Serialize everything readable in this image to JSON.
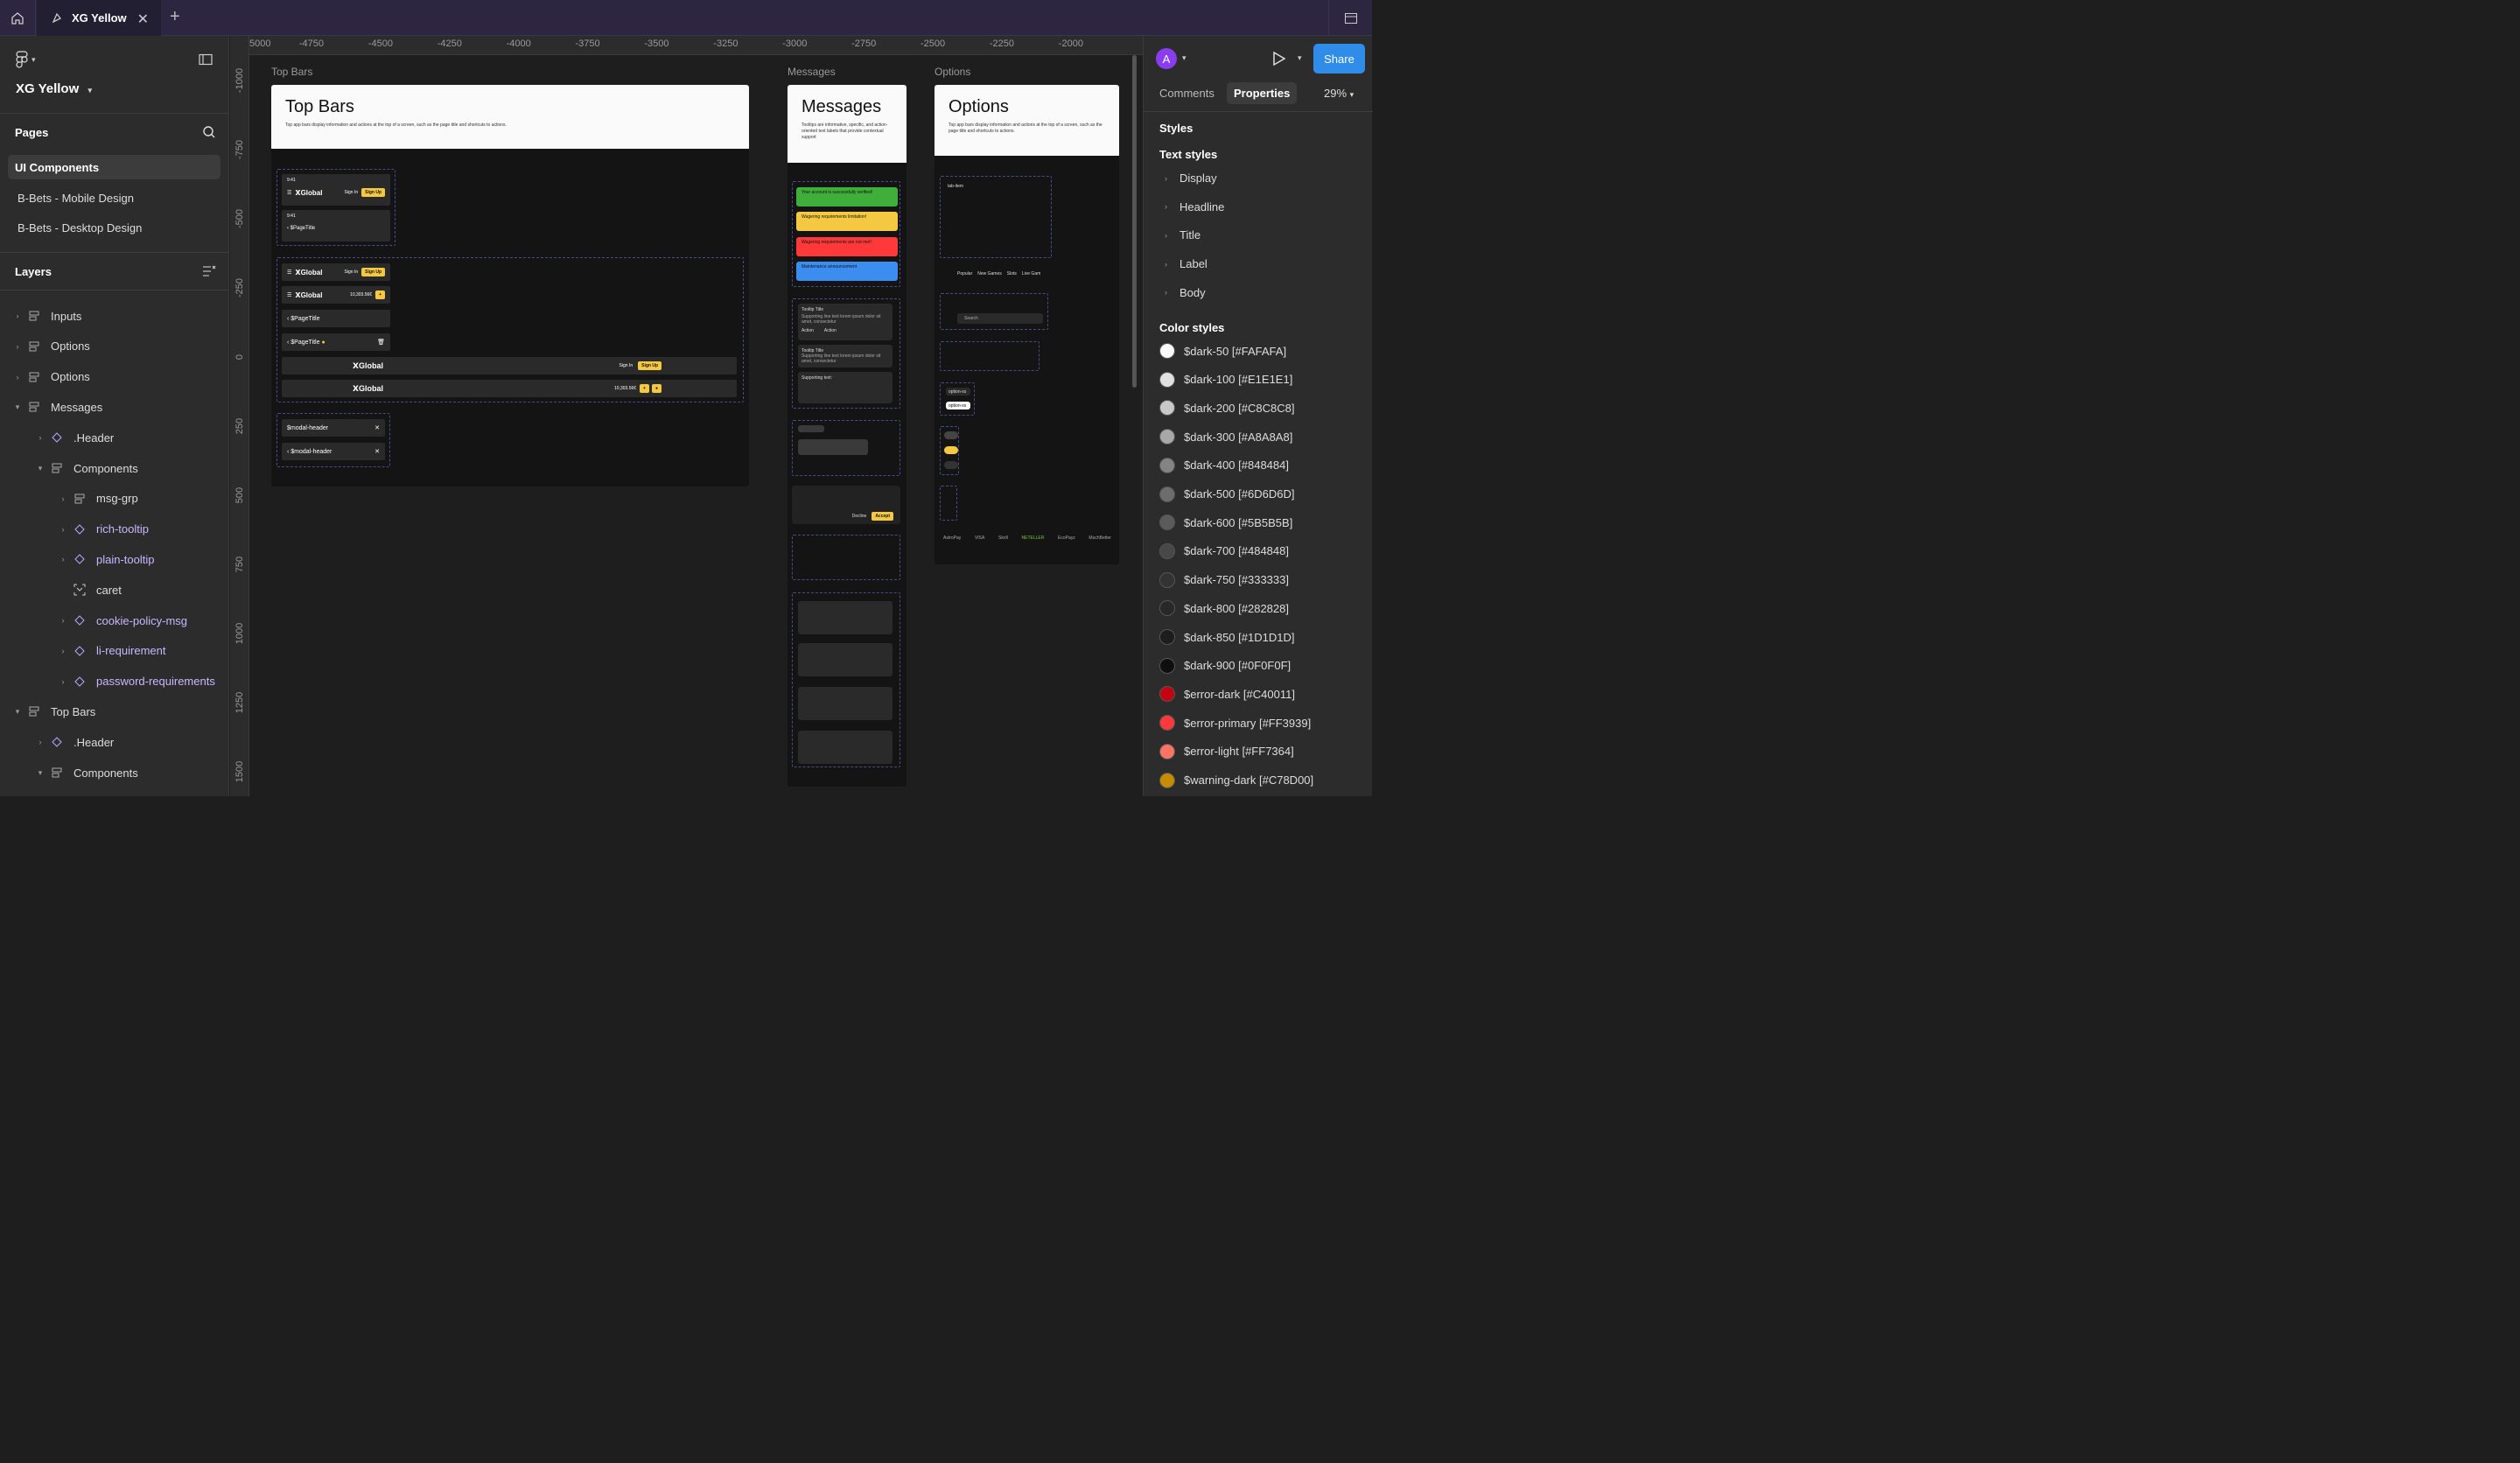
{
  "topbar": {
    "file_tab": "XG Yellow",
    "home_icon": "home-icon",
    "file_icon": "figma-file-icon",
    "close_icon": "close-icon",
    "add_icon": "plus-icon",
    "panel_icon": "layout-icon"
  },
  "left": {
    "file_name": "XG Yellow",
    "pages_title": "Pages",
    "pages": [
      "UI Components",
      "B-Bets - Mobile Design",
      "B-Bets - Desktop Design"
    ],
    "layers_title": "Layers",
    "layers": [
      {
        "label": "Inputs",
        "depth": 0,
        "expanded": false,
        "kind": "frame"
      },
      {
        "label": "Options",
        "depth": 0,
        "expanded": false,
        "kind": "frame"
      },
      {
        "label": "Options",
        "depth": 0,
        "expanded": false,
        "kind": "frame"
      },
      {
        "label": "Messages",
        "depth": 0,
        "expanded": true,
        "kind": "frame"
      },
      {
        "label": ".Header",
        "depth": 1,
        "expanded": false,
        "kind": "component"
      },
      {
        "label": "Components",
        "depth": 1,
        "expanded": true,
        "kind": "frame"
      },
      {
        "label": "msg-grp",
        "depth": 2,
        "expanded": false,
        "kind": "frame"
      },
      {
        "label": "rich-tooltip",
        "depth": 2,
        "expanded": false,
        "kind": "component"
      },
      {
        "label": "plain-tooltip",
        "depth": 2,
        "expanded": false,
        "kind": "component"
      },
      {
        "label": "caret",
        "depth": 2,
        "expanded": null,
        "kind": "vector"
      },
      {
        "label": "cookie-policy-msg",
        "depth": 2,
        "expanded": false,
        "kind": "component"
      },
      {
        "label": "li-requirement",
        "depth": 2,
        "expanded": false,
        "kind": "component"
      },
      {
        "label": "password-requirements",
        "depth": 2,
        "expanded": false,
        "kind": "component"
      },
      {
        "label": "Top Bars",
        "depth": 0,
        "expanded": true,
        "kind": "frame"
      },
      {
        "label": ".Header",
        "depth": 1,
        "expanded": false,
        "kind": "component"
      },
      {
        "label": "Components",
        "depth": 1,
        "expanded": true,
        "kind": "frame"
      }
    ]
  },
  "canvas": {
    "ruler_x": [
      "5000",
      "-4750",
      "-4500",
      "-4250",
      "-4000",
      "-3750",
      "-3500",
      "-3250",
      "-3000",
      "-2750",
      "-2500",
      "-2250",
      "-2000"
    ],
    "ruler_y": [
      "-1000",
      "-750",
      "-500",
      "-250",
      "0",
      "250",
      "500",
      "750",
      "1000",
      "1250",
      "1500"
    ],
    "frames": {
      "topbars": {
        "label": "Top Bars",
        "title": "Top Bars",
        "desc": "Top app bars display information and actions at the top of a screen, such as the page title and shortcuts to actions.",
        "time": "9:41",
        "brand": "Global",
        "signin": "Sign In",
        "signup": "Sign Up",
        "balance": "10,303.56€",
        "page_title": "$PageTitle",
        "modal_header": "$modal-header"
      },
      "messages": {
        "label": "Messages",
        "title": "Messages",
        "desc": "Tooltips are informative, specific, and action-oriented text labels that provide contextual support",
        "alerts": [
          {
            "text": "Your account is successfully verified!",
            "color": "#3fae3a"
          },
          {
            "text": "Wagering requirements limitation!",
            "color": "#f5c842"
          },
          {
            "text": "Wagering requirements are not met!",
            "color": "#ff3939"
          },
          {
            "text": "Maintenance announcement",
            "color": "#3b8df0"
          }
        ],
        "tooltip_title": "Tooltip Title",
        "tooltip_body": "Supporting line text lorem ipsum dolor sit amet, consectetur",
        "action": "Action",
        "supporting": "Supporting text:",
        "decline": "Decline",
        "accept": "Accept"
      },
      "options": {
        "label": "Options",
        "title": "Options",
        "desc": "Top app bars display information and actions at the top of a screen, such as the page title and shortcuts to actions.",
        "tab_item": "tab-item",
        "tabs": [
          "Popular",
          "New Games",
          "Slots",
          "Live Gam"
        ],
        "search": "Search",
        "option": "option-xs",
        "payments": [
          "AstroPay",
          "VISA",
          "Skrill",
          "NETELLER",
          "EcoPayz",
          "MuchBetter"
        ]
      }
    }
  },
  "right": {
    "avatar_initial": "A",
    "share_label": "Share",
    "tabs": [
      "Comments",
      "Properties"
    ],
    "zoom": "29%",
    "styles_title": "Styles",
    "text_styles_title": "Text styles",
    "text_styles": [
      "Display",
      "Headline",
      "Title",
      "Label",
      "Body"
    ],
    "color_styles_title": "Color styles",
    "color_styles": [
      {
        "label": "$dark-50 [#FAFAFA]",
        "color": "#FAFAFA"
      },
      {
        "label": "$dark-100 [#E1E1E1]",
        "color": "#E1E1E1"
      },
      {
        "label": "$dark-200 [#C8C8C8]",
        "color": "#C8C8C8"
      },
      {
        "label": "$dark-300 [#A8A8A8]",
        "color": "#A8A8A8"
      },
      {
        "label": "$dark-400 [#848484]",
        "color": "#848484"
      },
      {
        "label": "$dark-500 [#6D6D6D]",
        "color": "#6D6D6D"
      },
      {
        "label": "$dark-600 [#5B5B5B]",
        "color": "#5B5B5B"
      },
      {
        "label": "$dark-700 [#484848]",
        "color": "#484848"
      },
      {
        "label": "$dark-750 [#333333]",
        "color": "#333333"
      },
      {
        "label": "$dark-800 [#282828]",
        "color": "#282828"
      },
      {
        "label": "$dark-850 [#1D1D1D]",
        "color": "#1D1D1D"
      },
      {
        "label": "$dark-900 [#0F0F0F]",
        "color": "#0F0F0F"
      },
      {
        "label": "$error-dark [#C40011]",
        "color": "#C40011"
      },
      {
        "label": "$error-primary [#FF3939]",
        "color": "#FF3939"
      },
      {
        "label": "$error-light [#FF7364]",
        "color": "#FF7364"
      },
      {
        "label": "$warning-dark [#C78D00]",
        "color": "#C78D00"
      }
    ]
  }
}
